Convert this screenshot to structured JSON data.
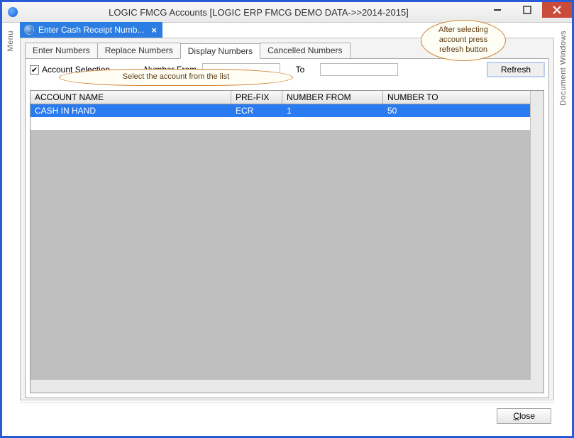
{
  "window": {
    "title": "LOGIC FMCG Accounts  [LOGIC ERP FMCG DEMO DATA->>2014-2015]"
  },
  "side": {
    "left": "Menu",
    "right": "Document Windows"
  },
  "doc_tab": {
    "title": "Enter Cash Receipt Numb..."
  },
  "tabs": {
    "t0": "Enter Numbers",
    "t1": "Replace Numbers",
    "t2": "Display Numbers",
    "t3": "Cancelled Numbers"
  },
  "filter": {
    "account_selection_label": "Account Selection",
    "number_from_label": "Number From",
    "to_label": "To",
    "number_from": "",
    "number_to": "",
    "refresh": "Refresh"
  },
  "grid": {
    "headers": {
      "c0": "ACCOUNT NAME",
      "c1": "PRE-FIX",
      "c2": "NUMBER FROM",
      "c3": "NUMBER TO"
    },
    "rows": [
      {
        "c0": "CASH IN HAND",
        "c1": "ECR",
        "c2": "1",
        "c3": "50"
      }
    ]
  },
  "callouts": {
    "refresh_hint": "After selecting account press refresh button",
    "list_hint": "Select the account from the list"
  },
  "buttons": {
    "close_prefix": "C",
    "close_rest": "lose"
  },
  "icons": {
    "check": "✔",
    "close_x": "×"
  }
}
